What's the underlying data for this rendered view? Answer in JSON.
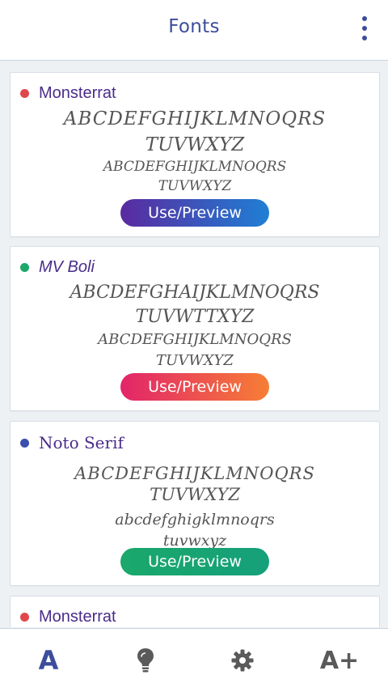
{
  "appbar": {
    "title": "Fonts",
    "menu_icon": "more-vert-icon"
  },
  "colors": {
    "primary": "#3d4d9b",
    "card_title": "#4a2c8a",
    "dot_red": "#e0474b",
    "dot_green": "#1aa86b",
    "dot_blue": "#3c4fae"
  },
  "cards": [
    {
      "title": "Monsterrat",
      "dot_color": "#e0474b",
      "sample_upper_1": "ABCDEFGHIJKLMNOQRS",
      "sample_upper_2": "TUVWXYZ",
      "sample_small_1": "ABCDEFGHIJKLMNOQRS",
      "sample_small_2": "TUVWXYZ",
      "button_label": "Use/Preview"
    },
    {
      "title": "MV Boli",
      "dot_color": "#1aa86b",
      "sample_upper_1": "ABCDEFGHAIJKLMNOQRS",
      "sample_upper_2": "TUVWTTXYZ",
      "sample_small_1": "ABCDEFGHIJKLMNOQRS",
      "sample_small_2": "TUVWXYZ",
      "button_label": "Use/Preview"
    },
    {
      "title": "Noto Serif",
      "dot_color": "#3c4fae",
      "sample_upper_1": "ABCDEFGHIJKLMNOQRS",
      "sample_upper_2": "TUVWXYZ",
      "sample_small_1": "abcdefghigklmnoqrs",
      "sample_small_2": "tuvwxyz",
      "button_label": "Use/Preview"
    },
    {
      "title": "Monsterrat",
      "dot_color": "#e0474b"
    }
  ],
  "bottom_nav": [
    {
      "label": "A",
      "icon": "fonts-icon",
      "active": true
    },
    {
      "icon": "lightbulb-icon"
    },
    {
      "icon": "gear-icon"
    },
    {
      "label": "A+",
      "icon": "text-size-icon"
    }
  ]
}
